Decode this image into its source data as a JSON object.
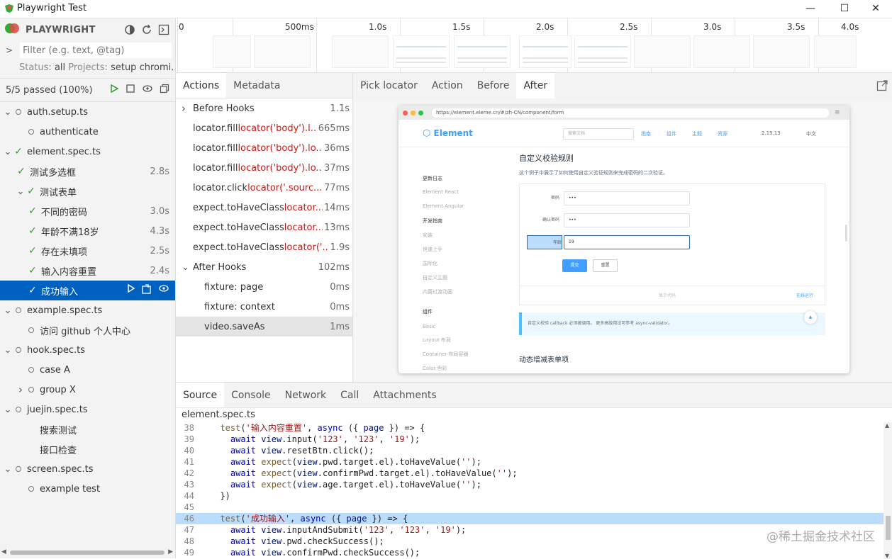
{
  "window": {
    "title": "Playwright Test",
    "minimize": "—",
    "maximize": "☐",
    "close": "✕"
  },
  "sidebar": {
    "brand": "PLAYWRIGHT",
    "filter_placeholder": "Filter (e.g. text, @tag)",
    "status_label": "Status:",
    "status_value": "all",
    "projects_label": "Projects:",
    "projects_value": "setup chromi...",
    "passed": "5/5 passed (100%)",
    "tree": [
      {
        "label": "auth.setup.ts",
        "kind": "file"
      },
      {
        "label": "authenticate",
        "kind": "test-circle"
      },
      {
        "label": "element.spec.ts",
        "kind": "file-pass"
      },
      {
        "label": "测试多选框",
        "kind": "pass1",
        "duration": "2.8s"
      },
      {
        "label": "测试表单",
        "kind": "group-pass"
      },
      {
        "label": "不同的密码",
        "kind": "pass2",
        "duration": "3.0s"
      },
      {
        "label": "年龄不满18岁",
        "kind": "pass2",
        "duration": "4.3s"
      },
      {
        "label": "存在未填项",
        "kind": "pass2",
        "duration": "2.5s"
      },
      {
        "label": "输入内容重置",
        "kind": "pass2",
        "duration": "2.4s"
      },
      {
        "label": "成功输入",
        "kind": "pass2-selected"
      },
      {
        "label": "example.spec.ts",
        "kind": "file"
      },
      {
        "label": "访问 github 个人中心",
        "kind": "test-circle"
      },
      {
        "label": "hook.spec.ts",
        "kind": "file"
      },
      {
        "label": "case A",
        "kind": "test-circle"
      },
      {
        "label": "group X",
        "kind": "group-circle"
      },
      {
        "label": "juejin.spec.ts",
        "kind": "file"
      },
      {
        "label": "搜索测试",
        "kind": "test-plain"
      },
      {
        "label": "接口检查",
        "kind": "test-plain"
      },
      {
        "label": "screen.spec.ts",
        "kind": "file"
      },
      {
        "label": "example test",
        "kind": "test-circle"
      }
    ]
  },
  "timeline": {
    "labels": [
      "0",
      "500ms",
      "1.0s",
      "1.5s",
      "2.0s",
      "2.5s",
      "3.0s",
      "3.5s",
      "4.0s"
    ]
  },
  "actions": {
    "tabs": [
      "Actions",
      "Metadata"
    ],
    "rows": [
      {
        "kind": "hook",
        "name": "Before Hooks",
        "loc": "",
        "duration": "1.1s"
      },
      {
        "kind": "action",
        "name": "locator.fill",
        "loc": "locator('body').l...",
        "duration": "665ms"
      },
      {
        "kind": "action",
        "name": "locator.fill",
        "loc": "locator('body').lo...",
        "duration": "36ms"
      },
      {
        "kind": "action",
        "name": "locator.fill",
        "loc": "locator('body').lo...",
        "duration": "37ms"
      },
      {
        "kind": "action",
        "name": "locator.click",
        "loc": "locator('.sourc...",
        "duration": "77ms"
      },
      {
        "kind": "action",
        "name": "expect.toHaveClass",
        "loc": "locator...",
        "duration": "14ms"
      },
      {
        "kind": "action",
        "name": "expect.toHaveClass",
        "loc": "locator...",
        "duration": "13ms"
      },
      {
        "kind": "action",
        "name": "expect.toHaveClass",
        "loc": "locator('...",
        "duration": "1.9s"
      },
      {
        "kind": "hook-open",
        "name": "After Hooks",
        "loc": "",
        "duration": "102ms"
      },
      {
        "kind": "sub",
        "name": "fixture: page",
        "loc": "",
        "duration": "0ms"
      },
      {
        "kind": "sub",
        "name": "fixture: context",
        "loc": "",
        "duration": "0ms"
      },
      {
        "kind": "sub-selected",
        "name": "video.saveAs",
        "loc": "",
        "duration": "1ms"
      }
    ]
  },
  "snapshot": {
    "tabs": [
      "Pick locator",
      "Action",
      "Before",
      "After"
    ],
    "url": "https://element.eleme.cn/#/zh-CN/component/form",
    "logo": "Element",
    "search": "搜索文档",
    "nav": [
      "指南",
      "组件",
      "主题",
      "资源"
    ],
    "version": "2.15.13",
    "lang": "中文",
    "heading": "自定义校验规则",
    "desc": "这个例子中展示了如何使用自定义验证规则来完成密码的二次验证。",
    "side_items": [
      "更新日志",
      "Element React",
      "Element Angular",
      "开发指南",
      "安装",
      "快速上手",
      "国际化",
      "自定义主题",
      "内置过渡动画",
      "组件",
      "Basic",
      "Layout 布局",
      "Container 布局容器",
      "Color 色彩"
    ],
    "fields": [
      {
        "label": "密码",
        "value": "•••"
      },
      {
        "label": "确认密码",
        "value": "•••"
      },
      {
        "label": "年龄",
        "value": "19"
      }
    ],
    "submit": "提交",
    "reset": "重置",
    "show_code": "显示代码",
    "run_online": "在线运行",
    "tip": "自定义校验 callback 必须被调用。 更多高级用法可参考 async-validator。",
    "next_heading": "动态增减表单项"
  },
  "source": {
    "tabs": [
      "Source",
      "Console",
      "Network",
      "Call",
      "Attachments"
    ],
    "file": "element.spec.ts",
    "lines": [
      {
        "n": "38",
        "t": "  test('输入内容重置', async ({ page }) => {"
      },
      {
        "n": "39",
        "t": "    await view.input('123', '123', '19');"
      },
      {
        "n": "40",
        "t": "    await view.resetBtn.click();"
      },
      {
        "n": "41",
        "t": "    await expect(view.pwd.target.el).toHaveValue('');"
      },
      {
        "n": "42",
        "t": "    await expect(view.confirmPwd.target.el).toHaveValue('');"
      },
      {
        "n": "43",
        "t": "    await expect(view.age.target.el).toHaveValue('');"
      },
      {
        "n": "44",
        "t": "  })"
      },
      {
        "n": "45",
        "t": ""
      },
      {
        "n": "46",
        "t": "  test('成功输入', async ({ page }) => {",
        "hl": true
      },
      {
        "n": "47",
        "t": "    await view.inputAndSubmit('123', '123', '19');"
      },
      {
        "n": "48",
        "t": "    await view.pwd.checkSuccess();"
      },
      {
        "n": "49",
        "t": "    await view.confirmPwd.checkSuccess();"
      }
    ]
  },
  "watermark": "@稀土掘金技术社区",
  "colors": {
    "accent": "#0060c0",
    "pass": "#2e9a2e",
    "locator": "#c41a16",
    "highlight": "#bcdcfc"
  }
}
